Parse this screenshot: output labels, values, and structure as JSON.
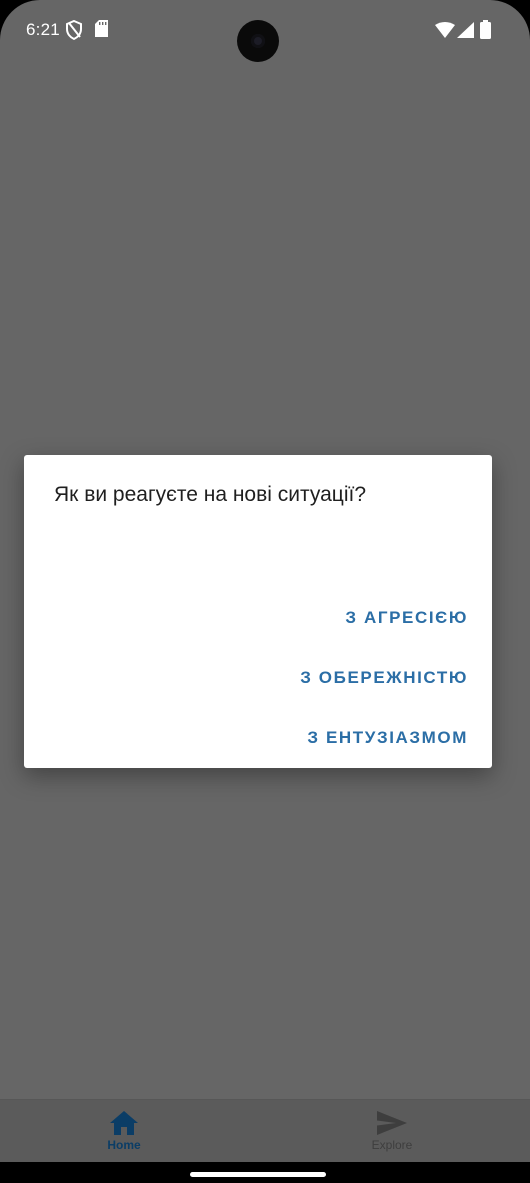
{
  "status_bar": {
    "time": "6:21",
    "icons_left": [
      "vpn-shield-icon",
      "sd-card-icon"
    ],
    "icons_right": [
      "wifi-icon",
      "cell-signal-icon",
      "battery-icon"
    ]
  },
  "dialog": {
    "title": "Як ви реагуєте на нові ситуації?",
    "options": [
      {
        "label": "З АГРЕСІЄЮ"
      },
      {
        "label": "З ОБЕРЕЖНІСТЮ"
      },
      {
        "label": "З ЕНТУЗІАЗМОМ"
      }
    ],
    "option_color": "#2b6ea6"
  },
  "bottom_nav": {
    "items": [
      {
        "label": "Home",
        "icon": "home-icon",
        "active": true
      },
      {
        "label": "Explore",
        "icon": "send-icon",
        "active": false
      }
    ],
    "active_color": "#0b3d66",
    "inactive_color": "#3e3e3e"
  },
  "colors": {
    "scrim": "#666666",
    "dialog_bg": "#ffffff"
  }
}
